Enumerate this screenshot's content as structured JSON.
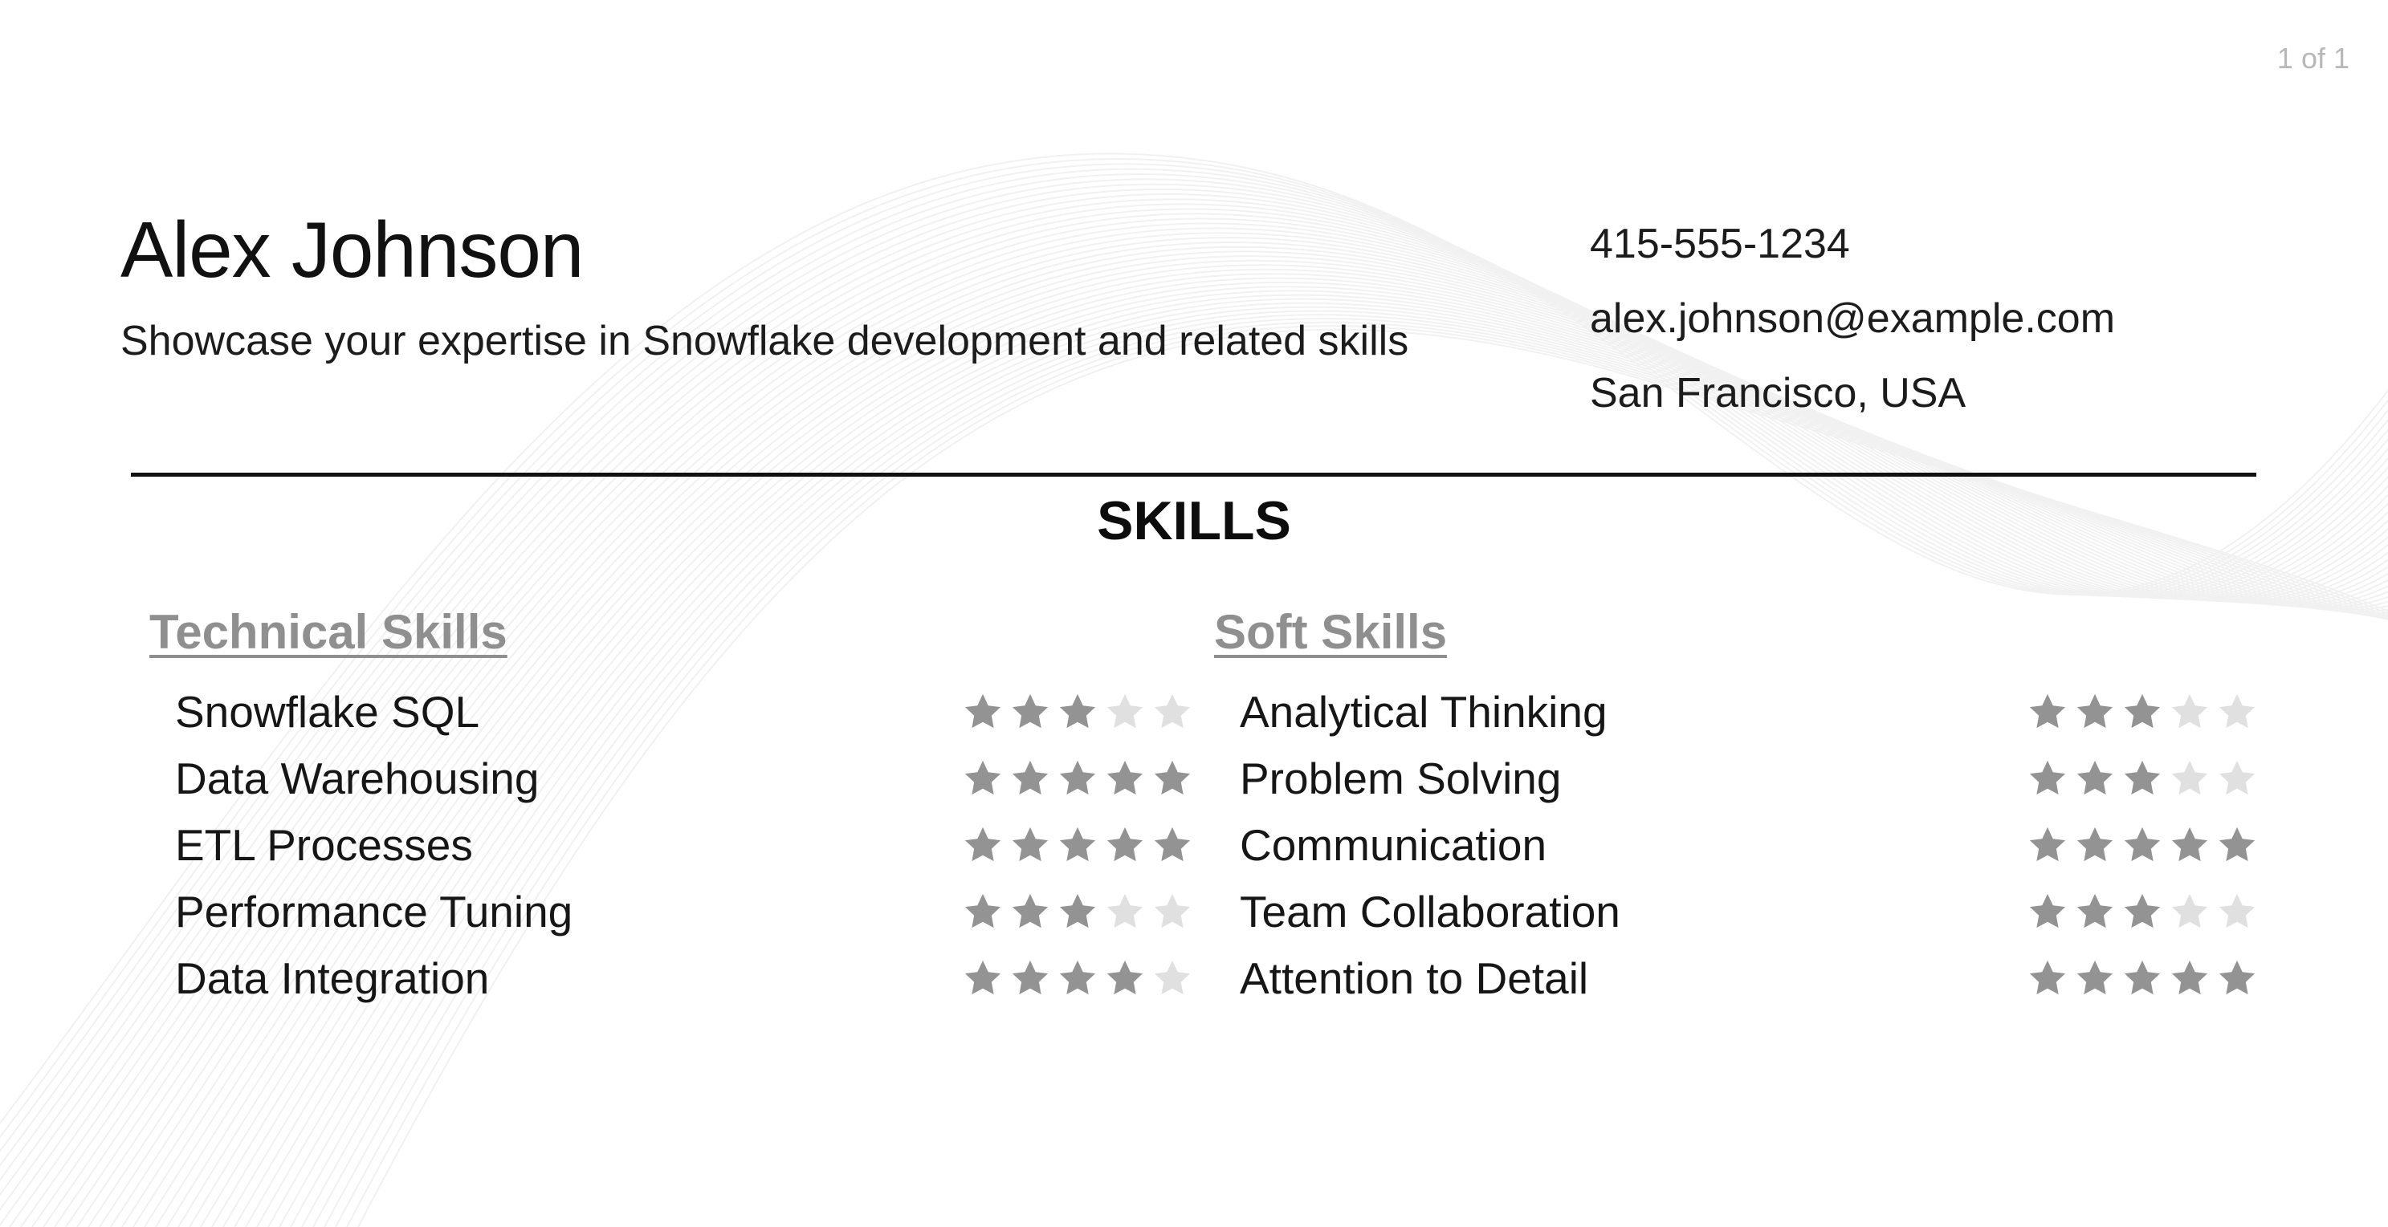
{
  "pagination": {
    "label": "1 of 1"
  },
  "header": {
    "name": "Alex Johnson",
    "tagline": "Showcase your expertise in Snowflake development and related skills",
    "contact": {
      "phone": "415-555-1234",
      "email": "alex.johnson@example.com",
      "location": "San Francisco, USA"
    }
  },
  "skills": {
    "title": "SKILLS",
    "max_rating": 5,
    "colors": {
      "filled": "#939393",
      "empty": "#e0e0e0"
    },
    "technical": {
      "heading": "Technical Skills",
      "items": [
        {
          "name": "Snowflake SQL",
          "rating": 3
        },
        {
          "name": "Data Warehousing",
          "rating": 5
        },
        {
          "name": "ETL Processes",
          "rating": 5
        },
        {
          "name": "Performance Tuning",
          "rating": 3
        },
        {
          "name": "Data Integration",
          "rating": 4
        }
      ]
    },
    "soft": {
      "heading": "Soft Skills",
      "items": [
        {
          "name": "Analytical Thinking",
          "rating": 3
        },
        {
          "name": "Problem Solving",
          "rating": 3
        },
        {
          "name": "Communication",
          "rating": 5
        },
        {
          "name": "Team Collaboration",
          "rating": 3
        },
        {
          "name": "Attention to Detail",
          "rating": 5
        }
      ]
    }
  }
}
